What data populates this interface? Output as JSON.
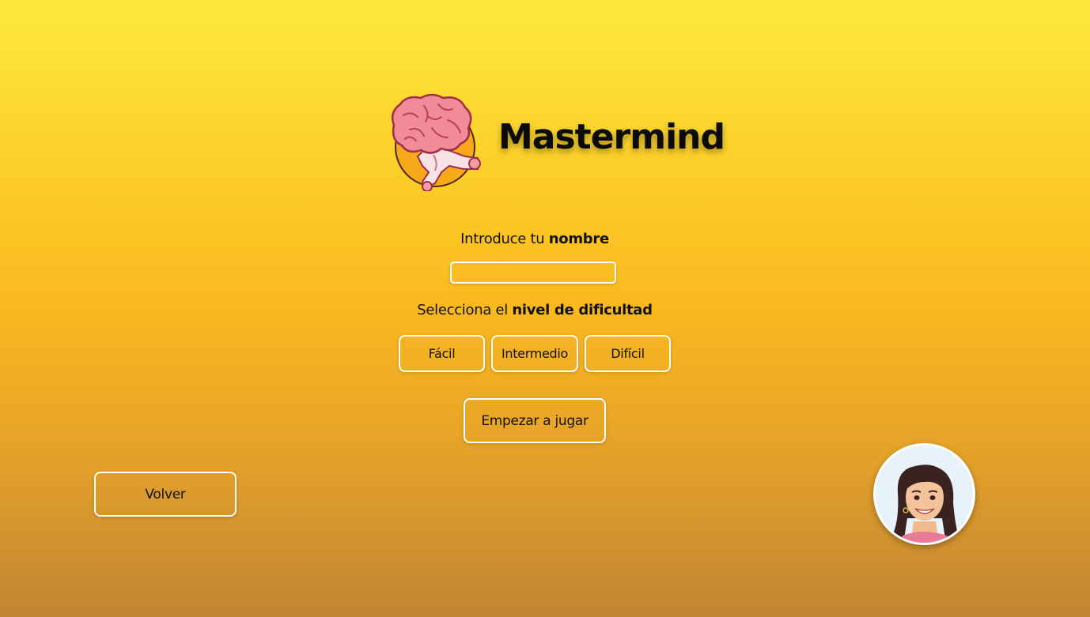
{
  "header": {
    "title": "Mastermind",
    "logo_icon": "brain-runner-icon"
  },
  "form": {
    "name_label_prefix": "Introduce tu ",
    "name_label_bold": "nombre",
    "name_value": "",
    "level_label_prefix": "Selecciona el ",
    "level_label_bold": "nivel de dificultad",
    "levels": [
      "Fácil",
      "Intermedio",
      "Difícil"
    ],
    "start_label": "Empezar a jugar"
  },
  "footer": {
    "back_label": "Volver",
    "avatar_icon": "user-avatar-icon"
  },
  "colors": {
    "background_top": "#fde93e",
    "background_bottom": "#c08532",
    "border": "#ffffff",
    "text": "#111111"
  }
}
